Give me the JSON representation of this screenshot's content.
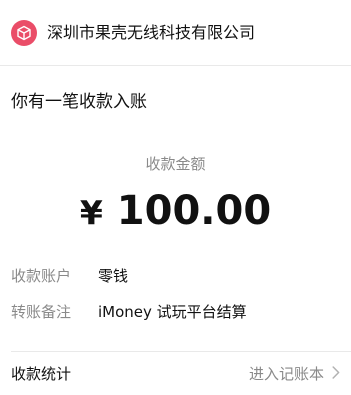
{
  "header": {
    "merchant_name": "深圳市果壳无线科技有限公司",
    "logo_icon": "cube-icon",
    "logo_color": "#ea4d68"
  },
  "notice": {
    "title": "你有一笔收款入账"
  },
  "amount": {
    "label": "收款金额",
    "currency": "¥",
    "value": "100.00"
  },
  "details": [
    {
      "label": "收款账户",
      "value": "零钱"
    },
    {
      "label": "转账备注",
      "value": "iMoney 试玩平台结算"
    }
  ],
  "footer": {
    "left_label": "收款统计",
    "link_label": "进入记账本",
    "link_icon": "chevron-right-icon"
  }
}
